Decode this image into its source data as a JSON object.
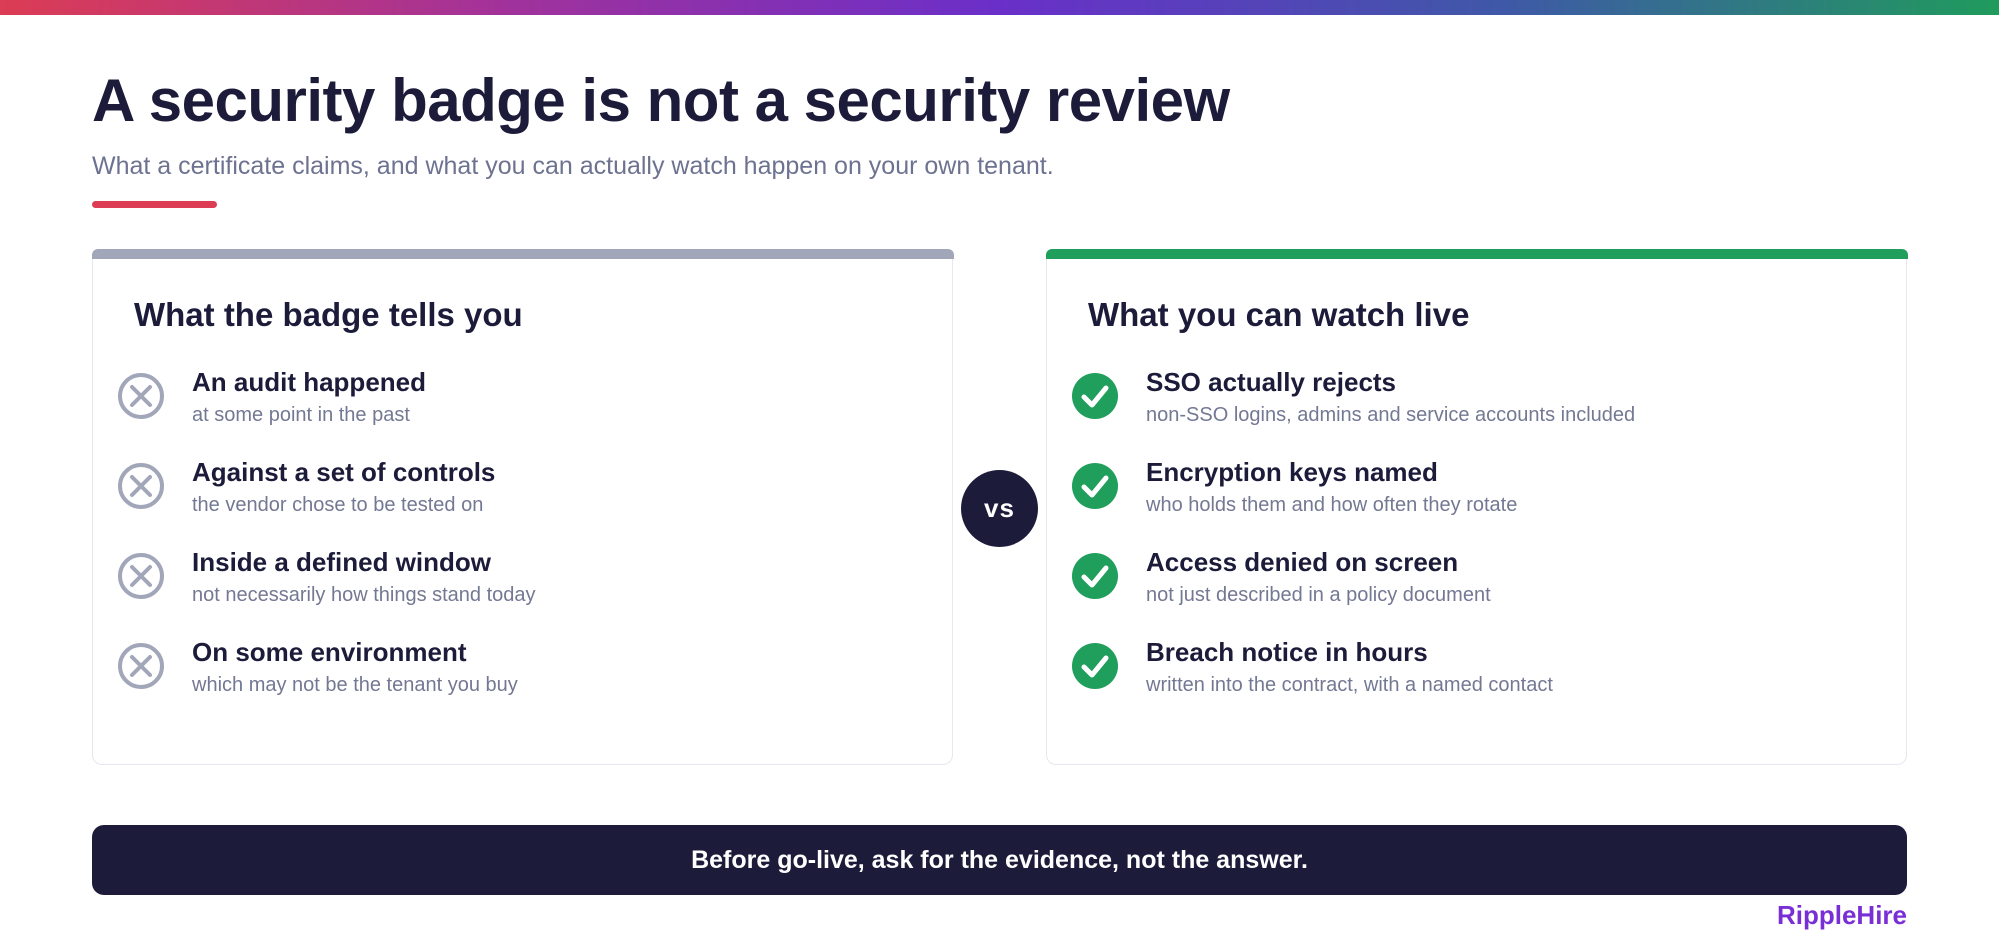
{
  "slide": {
    "title": "A security badge is not a security review",
    "subtitle": "What a certificate claims, and what you can actually watch happen on your own tenant."
  },
  "left_panel": {
    "heading": "What the badge tells you",
    "accent_color": "#a2a6b9",
    "icon": "x-circle-icon",
    "items": [
      {
        "title": "An audit happened",
        "detail": "at some point in the past"
      },
      {
        "title": "Against a set of controls",
        "detail": "the vendor chose to be tested on"
      },
      {
        "title": "Inside a defined window",
        "detail": "not necessarily how things stand today"
      },
      {
        "title": "On some environment",
        "detail": "which may not be the tenant you buy"
      }
    ]
  },
  "divider": {
    "label": "vs"
  },
  "right_panel": {
    "heading": "What you can watch live",
    "accent_color": "#1f9e5c",
    "icon": "check-circle-icon",
    "items": [
      {
        "title": "SSO actually rejects",
        "detail": "non-SSO logins, admins and service accounts included"
      },
      {
        "title": "Encryption keys named",
        "detail": "who holds them and how often they rotate"
      },
      {
        "title": "Access denied on screen",
        "detail": "not just described in a policy document"
      },
      {
        "title": "Breach notice in hours",
        "detail": "written into the contract, with a named contact"
      }
    ]
  },
  "callout": {
    "text": "Before go-live, ask for the evidence, not the answer."
  },
  "brand": {
    "name": "RippleHire",
    "color": "#7a2fd6"
  },
  "colors": {
    "title_rule": "#dc3c54",
    "navy": "#1c1c3a"
  }
}
